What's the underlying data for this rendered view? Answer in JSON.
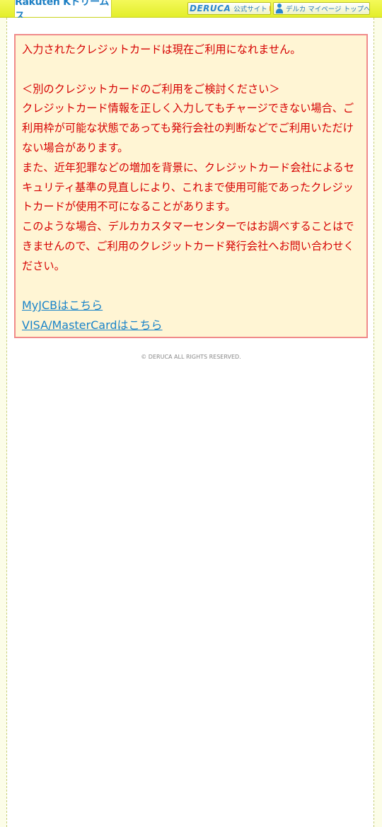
{
  "header": {
    "logo_text": "Rakuten Kドリームス",
    "deruca_mark": "DERUCA",
    "official_site_label": "公式サイト",
    "mypage_label": "デルカ マイページ トップへ"
  },
  "notice": {
    "line1": "入力されたクレジットカードは現在ご利用になれません。",
    "heading": "＜別のクレジットカードのご利用をご検討ください＞",
    "para1": "クレジットカード情報を正しく入力してもチャージできない場合、ご利用枠が可能な状態であっても発行会社の判断などでご利用いただけない場合があります。",
    "para2": "また、近年犯罪などの増加を背景に、クレジットカード会社によるセキュリティ基準の見直しにより、これまで使用可能であったクレジットカードが使用不可になることがあります。",
    "para3": "このような場合、デルカカスタマーセンターではお調べすることはできませんので、ご利用のクレジットカード発行会社へお問い合わせください。",
    "link_myjcb": "MyJCBはこちら",
    "link_visa": "VISA/MasterCardはこちら"
  },
  "footer": {
    "copyright": "© DERUCA ALL RIGHTS RESERVED."
  },
  "colors": {
    "header_bg": "#e8f23a",
    "notice_bg": "#fff5d4",
    "notice_border": "#f08a8a",
    "notice_text": "#d60000",
    "link": "#1a84c9"
  }
}
